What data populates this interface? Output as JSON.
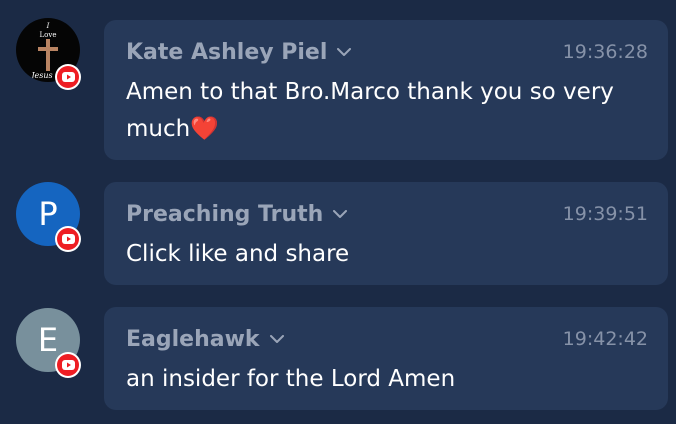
{
  "messages": [
    {
      "author": "Kate Ashley Piel",
      "time": "19:36:28",
      "text": "Amen to that Bro.Marco thank you so very much❤️",
      "avatar": {
        "type": "photo",
        "caption_top": "I",
        "caption_mid": "Love",
        "caption_script": "Jesus"
      },
      "platform_icon": "youtube-icon"
    },
    {
      "author": "Preaching Truth",
      "time": "19:39:51",
      "text": "Click like and share",
      "avatar": {
        "type": "letter",
        "letter": "P",
        "color": "#1565c0"
      },
      "platform_icon": "youtube-icon"
    },
    {
      "author": "Eaglehawk",
      "time": "19:42:42",
      "text": "an insider for the Lord Amen",
      "avatar": {
        "type": "letter",
        "letter": "E",
        "color": "#78909c"
      },
      "platform_icon": "youtube-icon"
    }
  ],
  "colors": {
    "background": "#1b2a45",
    "bubble": "#263959",
    "author": "#9aa5b8",
    "time": "#8692a8",
    "text": "#ffffff",
    "youtube": "#ee1d23"
  }
}
